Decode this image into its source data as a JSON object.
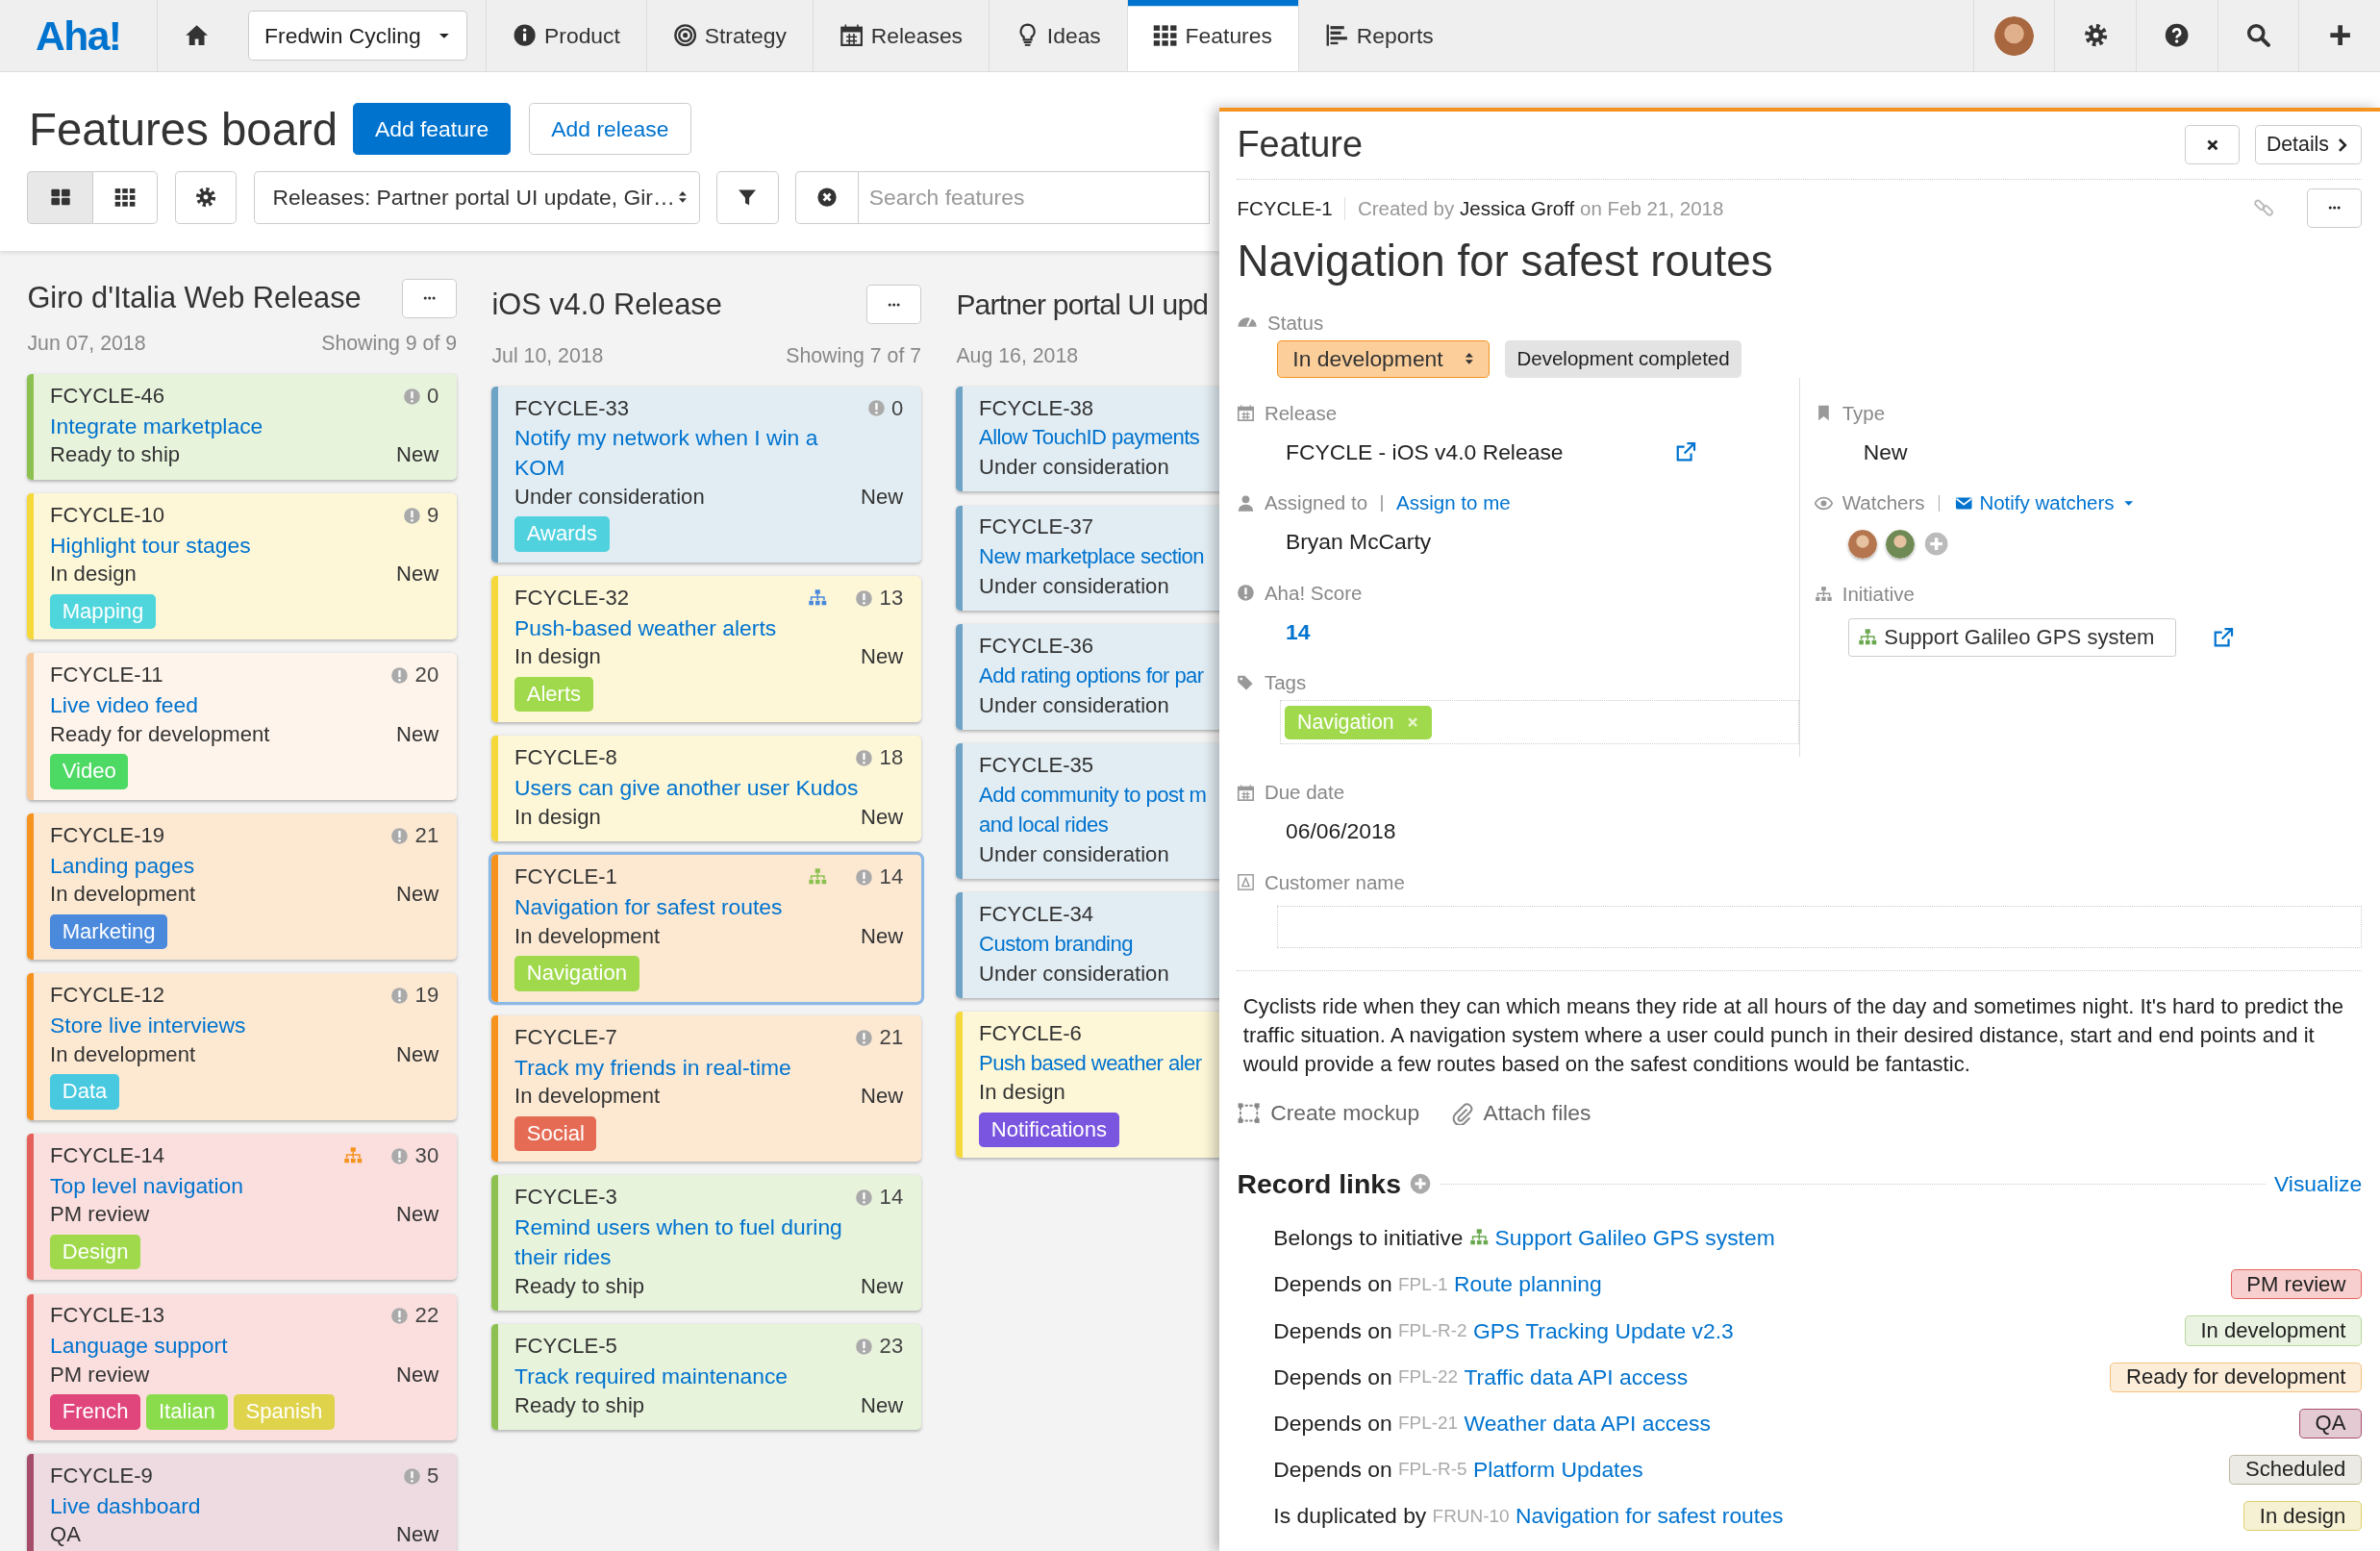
{
  "nav": {
    "logo": "Aha!",
    "workspace": "Fredwin Cycling",
    "tabs": [
      {
        "label": "Product",
        "selected": false
      },
      {
        "label": "Strategy",
        "selected": false
      },
      {
        "label": "Releases",
        "selected": false
      },
      {
        "label": "Ideas",
        "selected": false
      },
      {
        "label": "Features",
        "selected": true
      },
      {
        "label": "Reports",
        "selected": false
      }
    ]
  },
  "header": {
    "title": "Features board",
    "primary_button": "Add feature",
    "secondary_button": "Add release"
  },
  "toolbar": {
    "views": [
      {
        "kind": "board",
        "selected": true
      },
      {
        "kind": "grid",
        "selected": false
      }
    ],
    "release_filter": "Releases: Partner portal UI update, Gir…",
    "search": {
      "placeholder": "Search features"
    }
  },
  "columns": [
    {
      "title": "Giro d'Italia Web Release",
      "date": "Jun 07, 2018",
      "showing": "Showing 9 of 9",
      "cards": [
        {
          "id": "FCYCLE-46",
          "score": "0",
          "title": "Integrate marketplace",
          "status": "Ready to ship",
          "type": "New",
          "color": "#8cc152",
          "selected": false
        },
        {
          "id": "FCYCLE-10",
          "score": "9",
          "title": "Highlight tour stages",
          "status": "In design",
          "type": "New",
          "color": "#f5d93a",
          "selected": false,
          "tags": [
            {
              "label": "Mapping",
              "color": "#4fd6dc"
            }
          ]
        },
        {
          "id": "FCYCLE-11",
          "score": "20",
          "title": "Live video feed",
          "status": "Ready for development",
          "type": "New",
          "color": "#f8c99a",
          "selected": false,
          "tags": [
            {
              "label": "Video",
              "color": "#4cd964"
            }
          ]
        },
        {
          "id": "FCYCLE-19",
          "score": "21",
          "title": "Landing pages",
          "status": "In development",
          "type": "New",
          "color": "#f6921e",
          "selected": false,
          "tags": [
            {
              "label": "Marketing",
              "color": "#4a89dc"
            }
          ]
        },
        {
          "id": "FCYCLE-12",
          "score": "19",
          "title": "Store live interviews",
          "status": "In development",
          "type": "New",
          "color": "#f6921e",
          "selected": false,
          "tags": [
            {
              "label": "Data",
              "color": "#48c9e0"
            }
          ]
        },
        {
          "id": "FCYCLE-14",
          "score": "30",
          "title": "Top level navigation",
          "status": "PM review",
          "type": "New",
          "color": "#e5605a",
          "hierarchy": {
            "color": "#f6921e"
          },
          "selected": false,
          "tags": [
            {
              "label": "Design",
              "color": "#a0d94c"
            }
          ]
        },
        {
          "id": "FCYCLE-13",
          "score": "22",
          "title": "Language support",
          "status": "PM review",
          "type": "New",
          "color": "#e5605a",
          "selected": false,
          "tags": [
            {
              "label": "French",
              "color": "#e0457b"
            },
            {
              "label": "Italian",
              "color": "#8bdc4d"
            },
            {
              "label": "Spanish",
              "color": "#dfd34b"
            }
          ]
        },
        {
          "id": "FCYCLE-9",
          "score": "5",
          "title": "Live dashboard",
          "status": "QA",
          "type": "New",
          "color": "#a64d6b",
          "selected": false
        }
      ]
    },
    {
      "title": "iOS v4.0 Release",
      "date": "Jul 10, 2018",
      "showing": "Showing 7 of 7",
      "cards": [
        {
          "id": "FCYCLE-33",
          "score": "0",
          "title": "Notify my network when I win a KOM",
          "status": "Under consideration",
          "type": "New",
          "color": "#6ea3c5",
          "selected": false,
          "tags": [
            {
              "label": "Awards",
              "color": "#4fd1de"
            }
          ]
        },
        {
          "id": "FCYCLE-32",
          "score": "13",
          "title": "Push-based weather alerts",
          "status": "In design",
          "type": "New",
          "color": "#f5d93a",
          "hierarchy": {
            "color": "#4a89dc"
          },
          "selected": false,
          "tags": [
            {
              "label": "Alerts",
              "color": "#a0d94c"
            }
          ]
        },
        {
          "id": "FCYCLE-8",
          "score": "18",
          "title": "Users can give another user Kudos",
          "status": "In design",
          "type": "New",
          "color": "#f5d93a",
          "selected": false
        },
        {
          "id": "FCYCLE-1",
          "score": "14",
          "title": "Navigation for safest routes",
          "status": "In development",
          "type": "New",
          "color": "#f6921e",
          "hierarchy": {
            "color": "#8cc152"
          },
          "selected": true,
          "tags": [
            {
              "label": "Navigation",
              "color": "#a0d94c"
            }
          ]
        },
        {
          "id": "FCYCLE-7",
          "score": "21",
          "title": "Track my friends in real-time",
          "status": "In development",
          "type": "New",
          "color": "#f6921e",
          "selected": false,
          "tags": [
            {
              "label": "Social",
              "color": "#e56b55"
            }
          ]
        },
        {
          "id": "FCYCLE-3",
          "score": "14",
          "title": "Remind users when to fuel during their rides",
          "status": "Ready to ship",
          "type": "New",
          "color": "#8cc152",
          "selected": false
        },
        {
          "id": "FCYCLE-5",
          "score": "23",
          "title": "Track required maintenance",
          "status": "Ready to ship",
          "type": "New",
          "color": "#8cc152",
          "selected": false
        }
      ]
    },
    {
      "title": "Partner portal UI upd",
      "date": "Aug 16, 2018",
      "cards": [
        {
          "id": "FCYCLE-38",
          "title": "Allow TouchID payments",
          "status": "Under consideration",
          "color": "#6ea3c5",
          "selected": false
        },
        {
          "id": "FCYCLE-37",
          "title": "New marketplace section",
          "status": "Under consideration",
          "color": "#6ea3c5",
          "selected": false
        },
        {
          "id": "FCYCLE-36",
          "title": "Add rating options for par",
          "status": "Under consideration",
          "color": "#6ea3c5",
          "selected": false
        },
        {
          "id": "FCYCLE-35",
          "title": "Add community to post m\nand local rides",
          "status": "Under consideration",
          "color": "#6ea3c5",
          "selected": false
        },
        {
          "id": "FCYCLE-34",
          "title": "Custom branding",
          "status": "Under consideration",
          "color": "#6ea3c5",
          "selected": false
        },
        {
          "id": "FCYCLE-6",
          "title": "Push based weather aler",
          "status": "In design",
          "color": "#f5d93a",
          "selected": false,
          "tags": [
            {
              "label": "Notifications",
              "color": "#7a55e0"
            }
          ]
        }
      ]
    }
  ],
  "panel": {
    "title": "Feature",
    "details_button": "Details",
    "ref": "FCYCLE-1",
    "created": "Created by **Jessica Groff** on Feb 21, 2018",
    "feature_title": "Navigation for safest routes",
    "status": {
      "label": "Status",
      "value": "In development",
      "color": "#f6921e",
      "next": "Development completed"
    },
    "release": {
      "label": "Release",
      "value": "FCYCLE - iOS v4.0 Release"
    },
    "assigned": {
      "label": "Assigned to",
      "action": "Assign to me",
      "value": "Bryan McCarty"
    },
    "score": {
      "label": "Aha! Score",
      "value": "14"
    },
    "tags": {
      "label": "Tags",
      "items": [
        {
          "label": "Navigation",
          "color": "#a0d94c"
        }
      ]
    },
    "type": {
      "label": "Type",
      "value": "New"
    },
    "watchers": {
      "label": "Watchers",
      "action": "Notify watchers",
      "avatars": [
        {
          "color": "#b5764f"
        },
        {
          "color": "#6f8a55"
        }
      ]
    },
    "initiative": {
      "label": "Initiative",
      "value": "Support Galileo GPS system"
    },
    "due": {
      "label": "Due date",
      "value": "06/06/2018"
    },
    "customer": {
      "label": "Customer name"
    },
    "description": "Cyclists ride when they can which means they ride at all hours of the day and sometimes night. It's hard to predict the traffic situation. A navigation system where a user could punch in their desired distance, start and end points and it would provide a few routes based on the safest conditions would be fantastic.",
    "actions": [
      {
        "kind": "mockup",
        "label": "Create mockup"
      },
      {
        "kind": "attach",
        "label": "Attach files"
      }
    ],
    "record_links": {
      "title": "Record links",
      "visualize": "Visualize",
      "items": [
        {
          "kind": "initiative",
          "relation": "Belongs to initiative",
          "title": "Support Galileo GPS system"
        },
        {
          "kind": "feature",
          "relation": "Depends on",
          "ref": "FPL-1",
          "title": "Route planning",
          "status": "PM review",
          "color": "#e5605a"
        },
        {
          "kind": "feature",
          "relation": "Depends on",
          "ref": "FPL-R-2",
          "title": "GPS Tracking Update v2.3",
          "status": "In development",
          "color": "#b9d79a"
        },
        {
          "kind": "feature",
          "relation": "Depends on",
          "ref": "FPL-22",
          "title": "Traffic data API access",
          "status": "Ready for development",
          "color": "#f5c27f"
        },
        {
          "kind": "feature",
          "relation": "Depends on",
          "ref": "FPL-21",
          "title": "Weather data API access",
          "status": "QA",
          "color": "#a64d6b"
        },
        {
          "kind": "feature",
          "relation": "Depends on",
          "ref": "FPL-R-5",
          "title": "Platform Updates",
          "status": "Scheduled",
          "color": "#bdb8a4"
        },
        {
          "kind": "feature",
          "relation": "Is duplicated by",
          "ref": "FRUN-10",
          "title": "Navigation for safest routes",
          "status": "In design",
          "color": "#e1cf6b"
        }
      ]
    }
  }
}
